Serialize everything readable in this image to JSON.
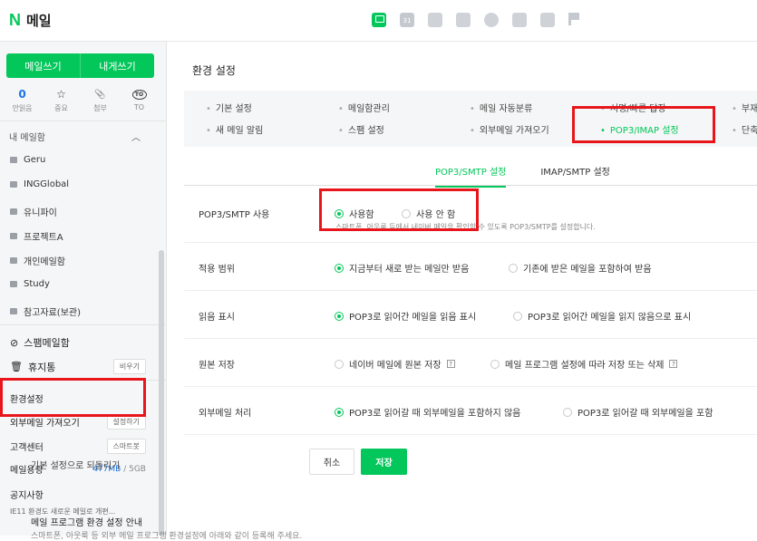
{
  "header": {
    "logo_mark": "N",
    "logo_text": "메일",
    "apps": [
      {
        "name": "mail-app-icon"
      },
      {
        "name": "calendar-app-icon",
        "text": "31"
      },
      {
        "name": "contacts-app-icon"
      },
      {
        "name": "addressbook-app-icon"
      },
      {
        "name": "drive-app-icon"
      },
      {
        "name": "apps-grid-icon"
      },
      {
        "name": "home-app-icon"
      },
      {
        "name": "bookmark-app-icon"
      }
    ]
  },
  "sidebar": {
    "write_mail": "메일쓰기",
    "write_self": "내게쓰기",
    "quick": [
      {
        "top": "0",
        "label": "안읽음"
      },
      {
        "top": "☆",
        "label": "중요"
      },
      {
        "top": "📎",
        "label": "첨부"
      },
      {
        "top": "TO",
        "label": "TO"
      }
    ],
    "mybox_title": "내 메일함",
    "mybox_toggle": "︿",
    "folders": [
      "Geru",
      "INGGlobal",
      "유니파이",
      "프로젝트A",
      "개인메일함",
      "Study",
      "참고자료(보관)"
    ],
    "spam": "스팸메일함",
    "trash": "휴지통",
    "trash_button": "비우기",
    "settings": "환경설정",
    "external": "외부메일 가져오기",
    "external_button": "설정하기",
    "customer": "고객센터",
    "customer_button": "스마트봇",
    "capacity_label": "메일용량",
    "capacity_used": "477MB",
    "capacity_total": "/ 5GB",
    "notice_title": "공지사항",
    "notice_text": "IE11 환경도 새로운 메일로 개편..."
  },
  "main": {
    "title": "환경 설정",
    "tabs_row1": [
      "기본 설정",
      "메일함관리",
      "메일 자동분류",
      "서명/빠른 답장",
      "부재중"
    ],
    "tabs_row2": [
      "새 메일 알림",
      "스팸 설정",
      "외부메일 가져오기",
      "POP3/IMAP 설정",
      "단축키"
    ],
    "subtabs": [
      "POP3/SMTP 설정",
      "IMAP/SMTP 설정"
    ],
    "rows": {
      "pop_use": {
        "label": "POP3/SMTP 사용",
        "on": "사용함",
        "off": "사용 안 함",
        "helper": "스마트폰, 아웃룩 등에서 네이버 메일을 확인할 수 있도록 POP3/SMTP를 설정합니다."
      },
      "scope": {
        "label": "적용 범위",
        "opt1": "지금부터 새로 받는 메일만 받음",
        "opt2": "기존에 받은 메일을 포함하여 받음"
      },
      "read": {
        "label": "읽음 표시",
        "opt1": "POP3로 읽어간 메일을 읽음 표시",
        "opt2": "POP3로 읽어간 메일을 읽지 않음으로 표시"
      },
      "keep": {
        "label": "원본 저장",
        "opt1": "네이버 메일에 원본 저장",
        "opt2": "메일 프로그램 설정에 따라 저장 또는 삭제"
      },
      "external": {
        "label": "외부메일 처리",
        "opt1": "POP3로 읽어갈 때 외부메일을 포함하지 않음",
        "opt2": "POP3로 읽어갈 때 외부메일을 포함"
      }
    },
    "help_mark": "?",
    "reset_label": "기본 설정으로 되돌리기",
    "cancel": "취소",
    "save": "저장",
    "guide_title": "메일 프로그램 환경 설정 안내",
    "guide_text": "스마트폰, 아웃룩 등 외부 메일 프로그램 환경설정에 아래와 같이 등록해 주세요."
  },
  "colors": {
    "accent": "#03c75a",
    "highlight": "#e8161b",
    "link": "#1a73e8"
  }
}
